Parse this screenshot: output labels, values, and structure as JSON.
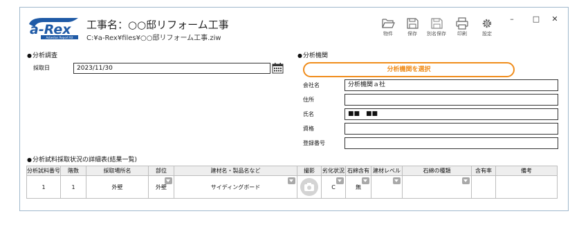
{
  "app": {
    "title": "工事名：○○邸リフォーム工事",
    "file_path": "C:¥a-Rex¥files¥○○邸リフォーム工事.ziw",
    "logo_text": "a-Rex",
    "logo_subtext": "Asbestos Report Kit"
  },
  "toolbar": {
    "items": [
      {
        "label": "物件",
        "icon": "folder-open-icon"
      },
      {
        "label": "保存",
        "icon": "save-icon"
      },
      {
        "label": "別名保存",
        "icon": "save-as-icon"
      },
      {
        "label": "印刷",
        "icon": "print-icon"
      },
      {
        "label": "設定",
        "icon": "gear-icon"
      }
    ]
  },
  "window_controls": {
    "minimize": "–",
    "maximize": "□",
    "close": "✕"
  },
  "survey": {
    "heading": "分析調査",
    "sample_date_label": "採取日",
    "sample_date_value": "2023/11/30",
    "calendar_icon": "calendar-icon"
  },
  "agency": {
    "heading": "分析機関",
    "select_button": "分析機関を選択",
    "fields": [
      {
        "label": "会社名",
        "value": "分析機関ａ社"
      },
      {
        "label": "住所",
        "value": ""
      },
      {
        "label": "氏名",
        "value": "■■　■■"
      },
      {
        "label": "資格",
        "value": ""
      },
      {
        "label": "登録番号",
        "value": ""
      }
    ]
  },
  "details": {
    "heading": "分析試料採取状況の詳細表(結果一覧)",
    "columns": [
      "分析試料番号",
      "階数",
      "採取場所名",
      "部位",
      "建材名・製品名など",
      "撮影",
      "劣化状況",
      "石綿含有",
      "建材レベル",
      "石綿の種類",
      "含有率",
      "備考"
    ],
    "rows": [
      {
        "sample_no": "1",
        "floor": "1",
        "location": "外壁",
        "part": "外壁",
        "material": "サイディングボード",
        "photo_icon": "camera-icon",
        "condition": "C",
        "asbestos": "無",
        "level": "",
        "type": "",
        "rate": "",
        "note": ""
      }
    ]
  },
  "colors": {
    "accent": "#f08c1a",
    "logo_blue": "#1f5aa6",
    "border": "#9fb8cc"
  }
}
